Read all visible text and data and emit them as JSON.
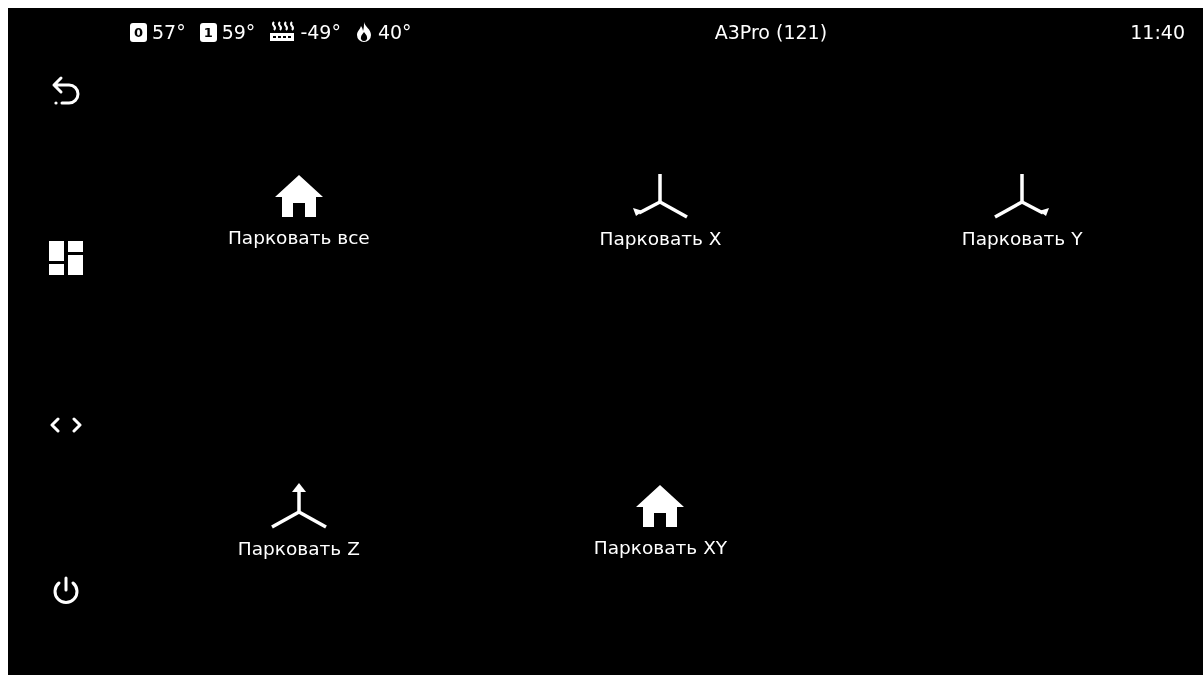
{
  "status_bar": {
    "temperatures": [
      {
        "kind": "extruder",
        "badge": "0",
        "reading": "57°"
      },
      {
        "kind": "extruder",
        "badge": "1",
        "reading": "59°"
      },
      {
        "kind": "bed",
        "reading": "-49°"
      },
      {
        "kind": "flame",
        "reading": "40°"
      }
    ],
    "title": "A3Pro (121)",
    "time": "11:40"
  },
  "sidebar": {
    "items": [
      {
        "kind": "back"
      },
      {
        "kind": "dashboard"
      },
      {
        "kind": "code"
      },
      {
        "kind": "power"
      }
    ]
  },
  "buttons": [
    {
      "kind": "home",
      "label": "Парковать все"
    },
    {
      "kind": "axis_x",
      "label": "Парковать X"
    },
    {
      "kind": "axis_y",
      "label": "Парковать Y"
    },
    {
      "kind": "axis_z",
      "label": "Парковать Z"
    },
    {
      "kind": "home",
      "label": "Парковать XY"
    }
  ]
}
